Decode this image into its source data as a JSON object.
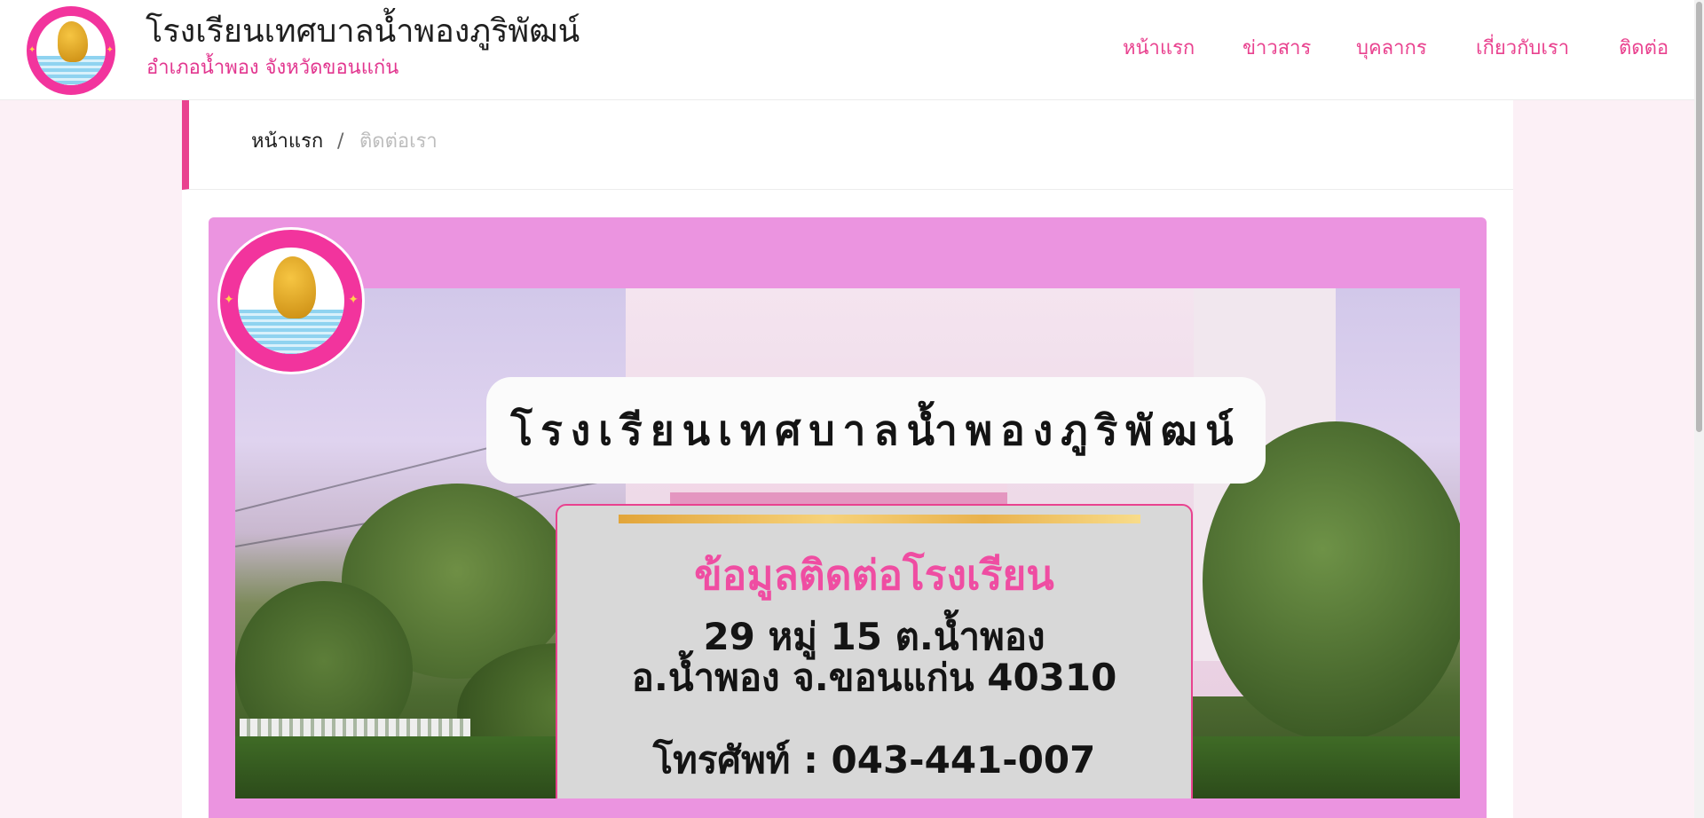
{
  "header": {
    "logo_icon": "school-emblem-icon",
    "title": "โรงเรียนเทศบาลน้ำพองภูริพัฒน์",
    "subtitle": "อำเภอน้ำพอง จังหวัดขอนแก่น"
  },
  "nav": {
    "items": [
      {
        "label": "หน้าแรก"
      },
      {
        "label": "ข่าวสาร"
      },
      {
        "label": "บุคลากร"
      },
      {
        "label": "เกี่ยวกับเรา"
      },
      {
        "label": "ติดต่อ"
      }
    ]
  },
  "breadcrumb": {
    "home": "หน้าแรก",
    "separator": "/",
    "current": "ติดต่อเรา"
  },
  "banner": {
    "school_name": "โรงเรียนเทศบาลน้ำพองภูริพัฒน์",
    "heading": "ข้อมูลติดต่อโรงเรียน",
    "address_line1": "29 หมู่ 15 ต.น้ำพอง",
    "address_line2": "อ.น้ำพอง จ.ขอนแก่น 40310",
    "phone": "โทรศัพท์ : 043-441-007"
  },
  "colors": {
    "accent": "#e9428f",
    "banner_background": "#eb94e0",
    "page_background": "#fcf0f6",
    "card_background": "#d8d8d8"
  }
}
